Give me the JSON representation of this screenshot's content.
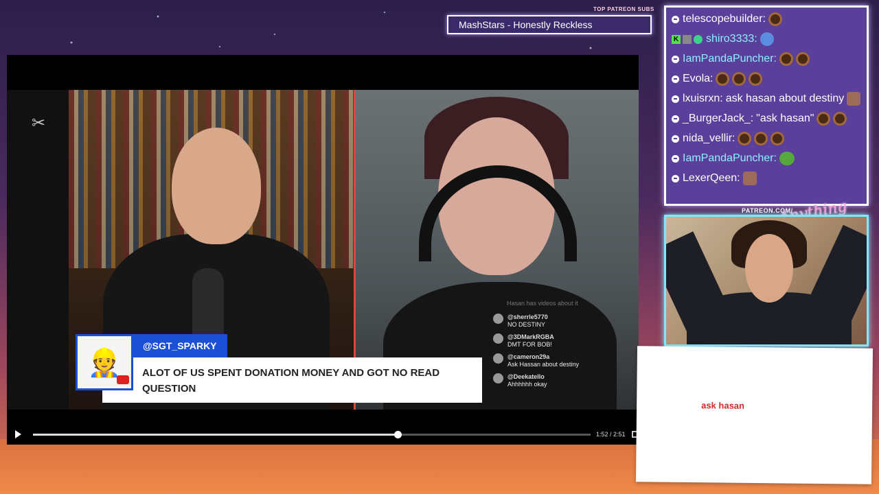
{
  "overlay": {
    "top_patreon_label": "TOP PATREON SUBS",
    "ticker_text": "MashStars - Honestly Reckless",
    "patreon_url_label": "PATREON.COM/",
    "logo_text": "Anything Else"
  },
  "video": {
    "question_card": {
      "username": "@SGT_SPARKY",
      "question": "ALOT OF US SPENT DONATION MONEY AND GOT NO READ QUESTION"
    },
    "comments_hint": "Hasan has videos about it",
    "comments": [
      {
        "user": "@sherrle5770",
        "text": "NO DESTINY"
      },
      {
        "user": "@3DMarkRGBA",
        "text": "DMT FOR BOB!"
      },
      {
        "user": "@cameron29a",
        "text": "Ask Hassan about destiny"
      },
      {
        "user": "@Deekatello",
        "text": "Ahhhhhh okay"
      }
    ],
    "time_display": "1:52 / 2:51",
    "progress": 0.654,
    "icons": {
      "play": "play-icon",
      "fullscreen": "fullscreen-icon",
      "watermark": "capcut-logo-icon"
    }
  },
  "chat": {
    "messages": [
      {
        "user": "telescopebuilder:",
        "text": "",
        "emotes": [
          "coin"
        ]
      },
      {
        "user": "shiro3333:",
        "text": "",
        "emotes": [
          "blue"
        ]
      },
      {
        "user": "IamPandaPuncher:",
        "text": "",
        "emotes": [
          "coin",
          "coin"
        ]
      },
      {
        "user": "Evola:",
        "text": "",
        "emotes": [
          "coin",
          "coin",
          "coin"
        ]
      },
      {
        "user": "lxuisrxn:",
        "text": "ask hasan about destiny",
        "emotes": [
          "face"
        ]
      },
      {
        "user": "_BurgerJack_:",
        "text": "\"ask hasan\"",
        "emotes": [
          "coin",
          "coin"
        ]
      },
      {
        "user": "nida_vellir:",
        "text": "",
        "emotes": [
          "coin",
          "coin",
          "coin"
        ]
      },
      {
        "user": "IamPandaPuncher:",
        "text": "",
        "emotes": [
          "frog"
        ]
      },
      {
        "user": "LexerQeen:",
        "text": "",
        "emotes": [
          "face"
        ]
      }
    ]
  },
  "note": {
    "text": "ask hasan"
  }
}
